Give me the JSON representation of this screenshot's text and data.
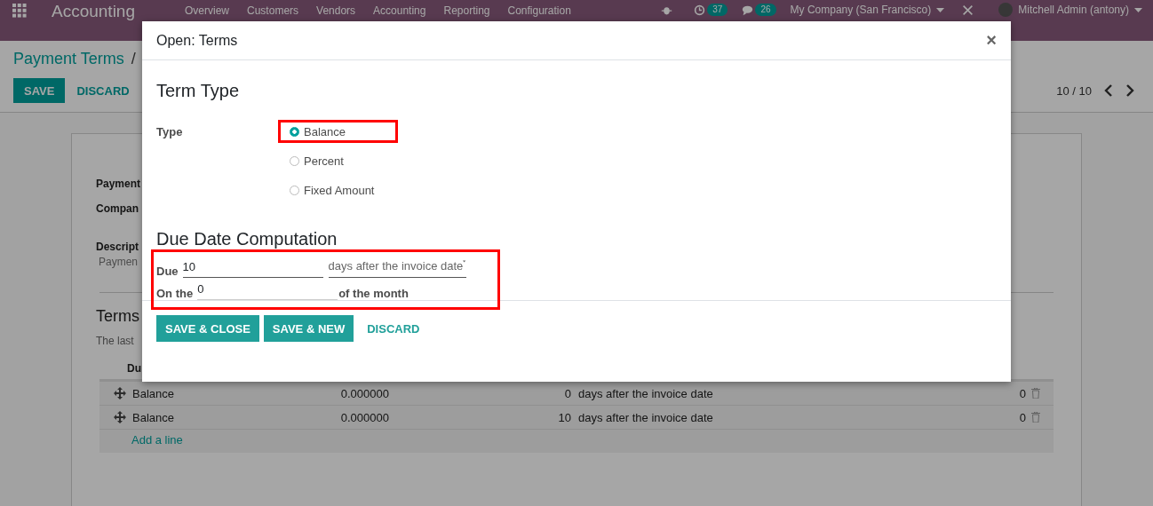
{
  "navbar": {
    "app_name": "Accounting",
    "menu": [
      "Overview",
      "Customers",
      "Vendors",
      "Accounting",
      "Reporting",
      "Configuration"
    ],
    "activity_count": "37",
    "message_count": "26",
    "company": "My Company (San Francisco)",
    "user": "Mitchell Admin (antony)"
  },
  "breadcrumb": {
    "parent": "Payment Terms",
    "separator": "/"
  },
  "buttons": [
    {
      "label": "SAVE",
      "kind": "primary"
    },
    {
      "label": "DISCARD",
      "kind": "link"
    }
  ],
  "pager": "10 / 10",
  "sheet": {
    "labels": [
      "Payment",
      "Compan",
      "Descript"
    ],
    "description_placeholder": "Paymen",
    "section_title": "Terms",
    "hint": "The last",
    "table": {
      "column_1": "Du",
      "rows": [
        {
          "value_type": "Balance",
          "value": "0.000000",
          "days": "0",
          "option": "days after the invoice date",
          "day_of_month": "0"
        },
        {
          "value_type": "Balance",
          "value": "0.000000",
          "days": "10",
          "option": "days after the invoice date",
          "day_of_month": "0"
        }
      ],
      "add_line": "Add a line"
    }
  },
  "dialog": {
    "title": "Open: Terms",
    "close": "×",
    "term_type_heading": "Term Type",
    "type_label": "Type",
    "type_options": [
      {
        "label": "Balance",
        "selected": true,
        "highlighted": true
      },
      {
        "label": "Percent",
        "selected": false,
        "highlighted": false
      },
      {
        "label": "Fixed Amount",
        "selected": false,
        "highlighted": false
      }
    ],
    "due_heading": "Due Date Computation",
    "due_highlighted": true,
    "due_label": "Due",
    "due_days": "10",
    "due_option": "days after the invoice date",
    "on_the_label": "On the",
    "day_of_month": "0",
    "of_month_label": "of the month",
    "buttons": [
      {
        "label": "SAVE & CLOSE",
        "kind": "primary"
      },
      {
        "label": "SAVE & NEW",
        "kind": "primary"
      },
      {
        "label": "DISCARD",
        "kind": "link"
      }
    ]
  }
}
